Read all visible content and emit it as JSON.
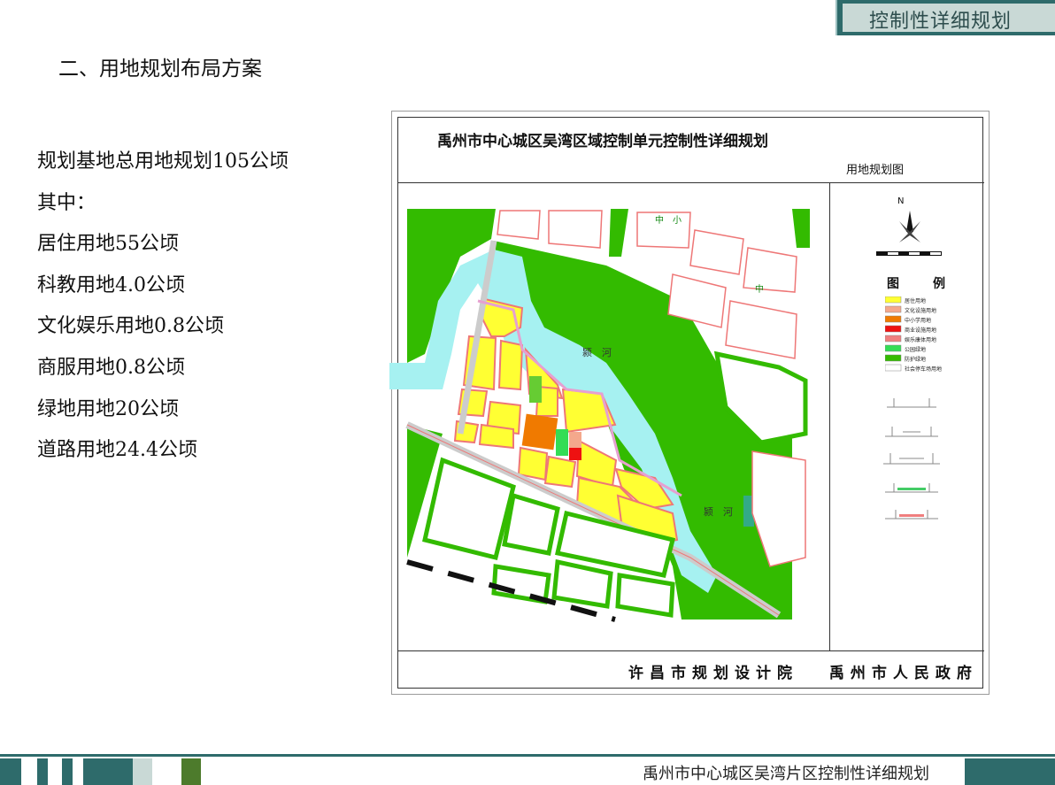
{
  "header": {
    "tab_label": "控制性详细规划"
  },
  "section": {
    "title": "二、用地规划布局方案"
  },
  "stats": {
    "total": "规划基地总用地规划105公顷",
    "among": "其中：",
    "residential": "居住用地55公顷",
    "education": "科教用地4.0公顷",
    "culture": "文化娱乐用地0.8公顷",
    "commercial": "商服用地0.8公顷",
    "green": "绿地用地20公顷",
    "road": "道路用地24.4公顷"
  },
  "map": {
    "title": "禹州市中心城区吴湾区域控制单元控制性详细规划",
    "subtitle": "用地规划图",
    "river_label_1": "颍　河",
    "river_label_2": "颍　河",
    "school_label": "中　小",
    "school_label_2": "中",
    "north": "N",
    "legend_title": "图　例",
    "legend": [
      {
        "label": "居住用地",
        "color": "#ffff33"
      },
      {
        "label": "文化设施用地",
        "color": "#f4a88c"
      },
      {
        "label": "中小学用地",
        "color": "#f07a00"
      },
      {
        "label": "商业设施用地",
        "color": "#ee1111"
      },
      {
        "label": "娱乐康体用地",
        "color": "#f07f7f"
      },
      {
        "label": "公园绿地",
        "color": "#33dd55"
      },
      {
        "label": "防护绿地",
        "color": "#33bb00"
      },
      {
        "label": "社会停车场用地",
        "color": "#ffffff"
      }
    ],
    "credit_1": "许昌市规划设计院",
    "credit_2": "禹州市人民政府"
  },
  "footer": {
    "title": "禹州市中心城区吴湾片区控制性详细规划"
  },
  "colors": {
    "teal": "#2e6b6b",
    "green_bar": "#4d7b2c",
    "water": "#a6f1f1",
    "green": "#33bb00",
    "residential": "#ffff33"
  }
}
